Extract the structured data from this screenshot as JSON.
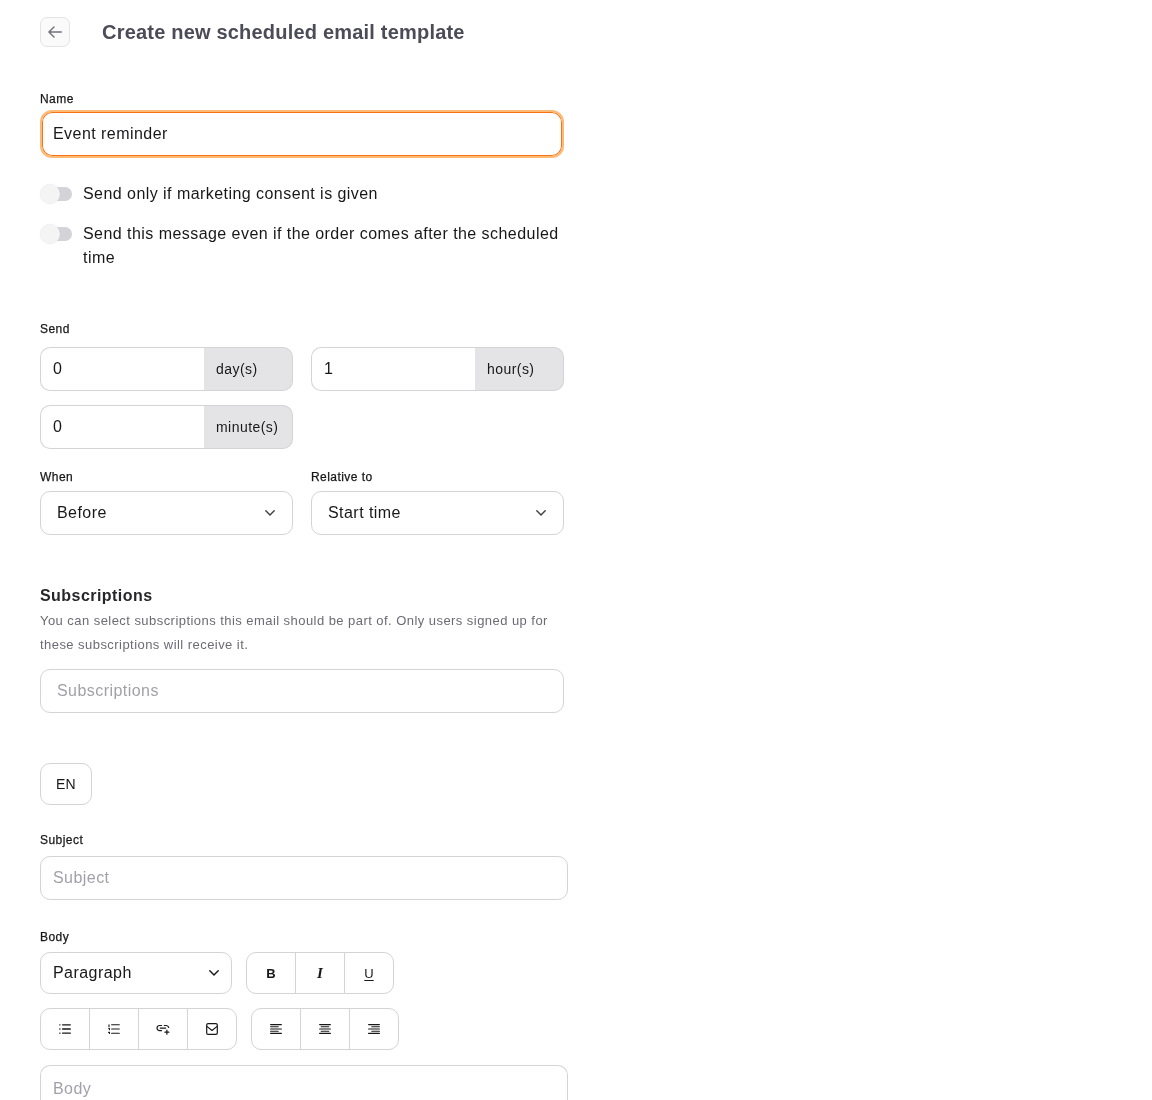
{
  "header": {
    "title": "Create new scheduled email template"
  },
  "name_field": {
    "label": "Name",
    "value": "Event reminder",
    "focused": true
  },
  "toggles": [
    {
      "label": "Send only if marketing consent is given",
      "on": false
    },
    {
      "label": "Send this message even if the order comes after the scheduled time",
      "on": false
    }
  ],
  "send": {
    "label": "Send",
    "amounts": [
      {
        "value": "0",
        "unit": "day(s)"
      },
      {
        "value": "1",
        "unit": "hour(s)"
      },
      {
        "value": "0",
        "unit": "minute(s)"
      }
    ]
  },
  "timing": [
    {
      "label": "When",
      "value": "Before"
    },
    {
      "label": "Relative to",
      "value": "Start time"
    }
  ],
  "subscriptions": {
    "title": "Subscriptions",
    "description": "You can select subscriptions this email should be part of. Only users signed up for these subscriptions will receive it.",
    "placeholder": "Subscriptions"
  },
  "languages": [
    {
      "label": "EN"
    }
  ],
  "subject": {
    "label": "Subject",
    "placeholder": "Subject"
  },
  "body": {
    "label": "Body",
    "block_format": "Paragraph",
    "format_buttons": [
      {
        "kind": "bold",
        "label": "B"
      },
      {
        "kind": "italic",
        "label": "I"
      },
      {
        "kind": "underline",
        "label": "U"
      }
    ],
    "placeholder": "Body"
  }
}
